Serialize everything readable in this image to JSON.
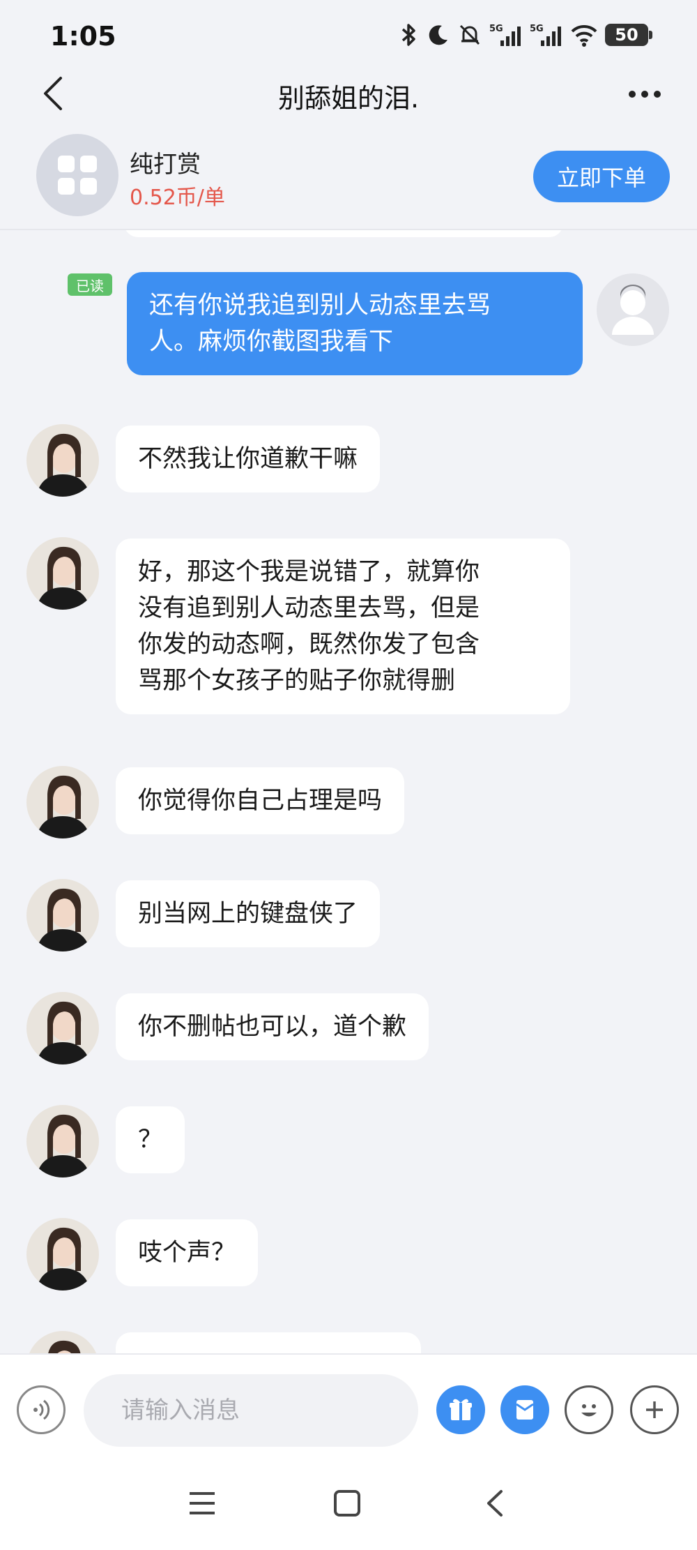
{
  "status_bar": {
    "time": "1:05",
    "battery": "50",
    "icons": [
      "bluetooth-icon",
      "moon-icon",
      "bell-off-icon",
      "5g-signal-icon",
      "5g-signal-icon",
      "wifi-icon",
      "battery-icon"
    ]
  },
  "header": {
    "title": "别舔姐的泪.",
    "back_icon": "chevron-left-icon",
    "more_icon": "more-icon"
  },
  "order_card": {
    "service_name": "纯打赏",
    "price": "0.52币/单",
    "order_button": "立即下单",
    "accent_color": "#3d8ff2",
    "price_color": "#e4574b"
  },
  "messages": [
    {
      "direction": "out",
      "read_badge": "已读",
      "lines": [
        "还有你说我追到别人动态里去骂",
        "人。麻烦你截图我看下"
      ]
    },
    {
      "direction": "in",
      "lines": [
        "不然我让你道歉干嘛"
      ]
    },
    {
      "direction": "in",
      "lines": [
        "好，那这个我是说错了，就算你",
        "没有追到别人动态里去骂，但是",
        "你发的动态啊，既然你发了包含",
        "骂那个女孩子的贴子你就得删"
      ]
    },
    {
      "direction": "in",
      "lines": [
        "你觉得你自己占理是吗"
      ]
    },
    {
      "direction": "in",
      "lines": [
        "别当网上的键盘侠了"
      ]
    },
    {
      "direction": "in",
      "lines": [
        "你不删帖也可以，道个歉"
      ]
    },
    {
      "direction": "in",
      "lines": [
        "？"
      ]
    },
    {
      "direction": "in",
      "lines": [
        "吱个声？"
      ]
    }
  ],
  "input_bar": {
    "placeholder": "请输入消息",
    "voice_icon": "voice-icon",
    "gift_icon": "gift-icon",
    "red-packet_icon": "red-packet-icon",
    "emoji_icon": "emoji-icon",
    "plus_icon": "plus-icon"
  },
  "system_nav": {
    "icons": [
      "menu-icon",
      "home-square-icon",
      "back-triangle-icon"
    ]
  }
}
